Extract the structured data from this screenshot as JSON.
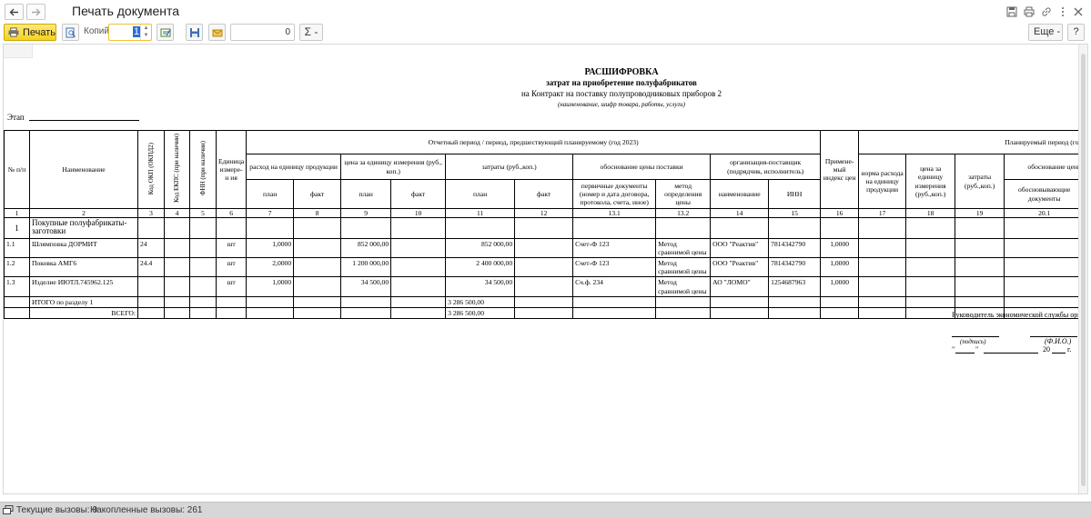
{
  "window": {
    "title": "Печать документа"
  },
  "toolbar": {
    "print_label": "Печать",
    "copies_label": "Копий:",
    "copies_value": "1",
    "sum_field_value": "0",
    "sum_label": "Σ -",
    "more_label": "Еще -",
    "help_label": "?"
  },
  "report": {
    "title": "РАСШИФРОВКА",
    "subtitle": "затрат на приобретение полуфабрикатов",
    "contract": "на Контракт на поставку полупроводниковых приборов 2",
    "contract_hint": "(наименование, шифр товара, работы, услуги)",
    "etap_label": "Этап",
    "headers": {
      "npp": "№ п/п",
      "name": "Наименование",
      "okp": "Код ОКП (ОКПД2)",
      "ektps": "Код ЕКПС (при наличии)",
      "fnn": "ФНН (при наличии)",
      "unit": "Единица измере-н ия",
      "report_period": "Отчетный период / период, предшествующий планируемому (год 2023)",
      "consumption": "расход на единицу продукции",
      "unit_price": "цена за единицу измерения (руб., коп.)",
      "costs": "затраты (руб.,коп.)",
      "justification": "обоснование цены поставки",
      "supplier": "организация-поставщик (подрядчик, исполнитель)",
      "plan": "план",
      "fact": "факт",
      "primary_docs": "первичные документы (номер и дата договора, протокола, счета, иное)",
      "method": "метод определения цены",
      "supplier_name": "наименование",
      "inn": "ИНН",
      "applied_index": "Примене-мый индекс цен",
      "planned_period": "Планируемый период (год",
      "norm": "норма расхода на единицу продукции",
      "unit_price2": "цена за единицу измерения (руб.,коп.)",
      "costs2": "затраты (руб.,коп.)",
      "justification2": "обоснование цены",
      "justifying_docs": "обосновывающие документы"
    },
    "col_numbers": [
      "1",
      "2",
      "3",
      "4",
      "5",
      "6",
      "7",
      "8",
      "9",
      "10",
      "11",
      "12",
      "13.1",
      "13.2",
      "14",
      "15",
      "16",
      "17",
      "18",
      "19",
      "20.1"
    ],
    "section": {
      "num": "1",
      "name": "Покупные полуфабрикаты-заготовки"
    },
    "rows": [
      {
        "num": "1.1",
        "name": "Шлямповка ДОРМИТ",
        "okp": "24",
        "unit": "шт",
        "cons_plan": "1,0000",
        "price_plan": "852 000,00",
        "cost_plan": "852 000,00",
        "doc": "Счет-Ф 123",
        "method": "Метод сравнимой цены",
        "supplier": "ООО \"Реактив\"",
        "inn": "7814342790",
        "index": "1,0000"
      },
      {
        "num": "1.2",
        "name": "Поковка АМГ6",
        "okp": "24.4",
        "unit": "шт",
        "cons_plan": "2,0000",
        "price_plan": "1 200 000,00",
        "cost_plan": "2 400 000,00",
        "doc": "Счет-Ф 123",
        "method": "Метод сравнимой цены",
        "supplier": "ООО \"Реактив\"",
        "inn": "7814342790",
        "index": "1,0000"
      },
      {
        "num": "1.3",
        "name": "Изделие ИЮТЛ.745962.125",
        "okp": "",
        "unit": "шт",
        "cons_plan": "1,0000",
        "price_plan": "34 500,00",
        "cost_plan": "34 500,00",
        "doc": "Сч.ф. 234",
        "method": "Метод сравнимой цены",
        "supplier": "АО \"ЛОМО\"",
        "inn": "1254687963",
        "index": "1,0000"
      }
    ],
    "total_section_label": "ИТОГО по разделу 1",
    "total_section_value": "3 286 500,00",
    "grand_total_label": "ВСЕГО:",
    "grand_total_value": "3 286 500,00",
    "signature": {
      "role": "Руководитель экономической службы орга",
      "sign_hint": "(подпись)",
      "fio_hint": "(Ф.И.О.)",
      "date_prefix": "\"",
      "date_mid": "\"",
      "year": "20",
      "year_suffix": "г."
    }
  },
  "status": {
    "current_calls": "Текущие вызовы: 0",
    "accumulated_calls": "Накопленные вызовы: 261"
  }
}
